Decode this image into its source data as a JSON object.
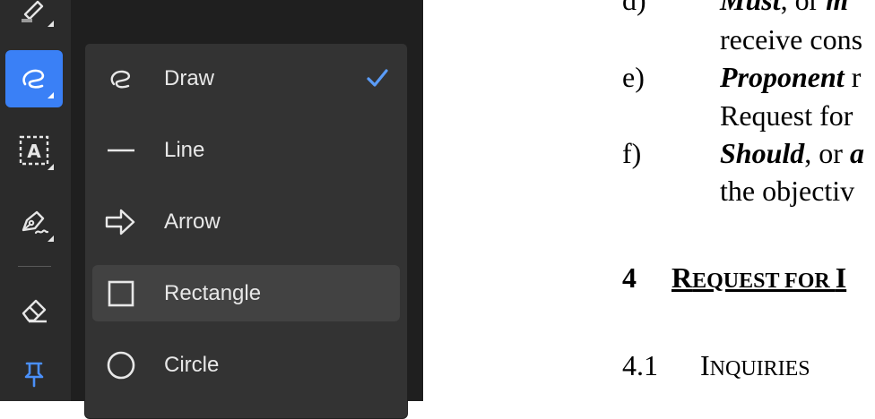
{
  "rail": {
    "tools": [
      {
        "name": "highlight-tool",
        "icon": "highlighter-icon"
      },
      {
        "name": "draw-tool",
        "icon": "freehand-draw-icon",
        "active": true
      },
      {
        "name": "text-box-tool",
        "icon": "text-box-icon"
      },
      {
        "name": "pen-tool",
        "icon": "pen-icon"
      },
      {
        "name": "eraser-tool",
        "icon": "eraser-icon"
      },
      {
        "name": "pin-tool",
        "icon": "pin-icon"
      }
    ],
    "accent": "#3a80f6"
  },
  "menu": {
    "items": [
      {
        "label": "Draw",
        "icon": "freehand-draw-icon",
        "checked": true
      },
      {
        "label": "Line",
        "icon": "line-icon"
      },
      {
        "label": "Arrow",
        "icon": "arrow-icon"
      },
      {
        "label": "Rectangle",
        "icon": "rectangle-icon",
        "hovered": true
      },
      {
        "label": "Circle",
        "icon": "circle-icon"
      }
    ],
    "check_color": "#5a9cf8"
  },
  "document": {
    "item_d": {
      "marker": "d)",
      "term": "Must",
      "rest": ", or ",
      "term2": "m",
      "line2": "receive cons"
    },
    "item_e": {
      "marker": "e)",
      "term": "Proponent",
      "rest": " r",
      "line2": "Request for"
    },
    "item_f": {
      "marker": "f)",
      "term": "Should",
      "rest": ", or ",
      "term2": "a",
      "line2": "the objectiv"
    },
    "section4": {
      "number": "4",
      "title_cap": "R",
      "title_small": "EQUEST FOR ",
      "title_cap2": "I"
    },
    "section41": {
      "number": "4.1",
      "title_cap": "I",
      "title_small": "NQUIRIES"
    }
  }
}
